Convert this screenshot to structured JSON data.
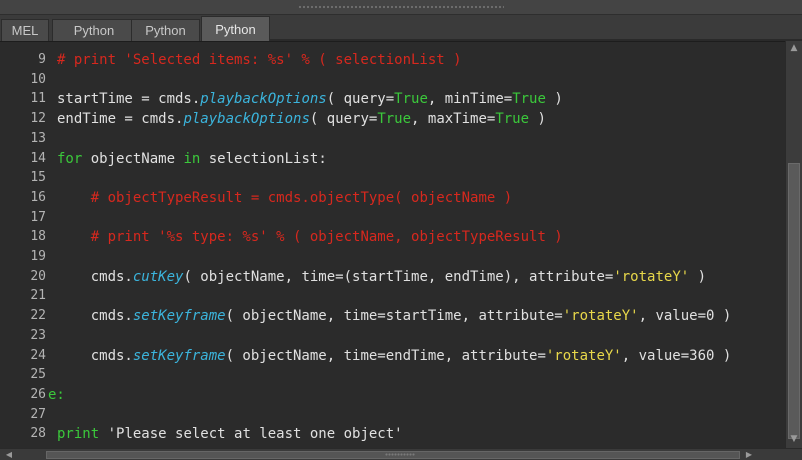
{
  "tabs": [
    {
      "label": "MEL",
      "active": false
    },
    {
      "label": "Python",
      "active": false
    },
    {
      "label": "Python",
      "active": false
    },
    {
      "label": "Python",
      "active": true
    }
  ],
  "colors": {
    "comment": "#d7281e",
    "keyword": "#3bc83b",
    "function": "#3bb4dc",
    "string": "#e8d84a",
    "text": "#e0e0e0",
    "background": "#2b2b2b"
  },
  "scroll_icons": {
    "up": "triangle-up-icon",
    "down": "triangle-down-icon",
    "left": "triangle-left-icon",
    "right": "triangle-right-icon"
  },
  "lines": [
    {
      "n": "9",
      "tokens": [
        {
          "t": "comment",
          "v": "# print 'Selected items: %s' % ( selectionList )"
        }
      ]
    },
    {
      "n": "10",
      "tokens": []
    },
    {
      "n": "11",
      "tokens": [
        {
          "t": "text",
          "v": "startTime = cmds."
        },
        {
          "t": "function",
          "v": "playbackOptions"
        },
        {
          "t": "text",
          "v": "( query="
        },
        {
          "t": "boolean",
          "v": "True"
        },
        {
          "t": "text",
          "v": ", minTime="
        },
        {
          "t": "boolean",
          "v": "True"
        },
        {
          "t": "text",
          "v": " )"
        }
      ]
    },
    {
      "n": "12",
      "tokens": [
        {
          "t": "text",
          "v": "endTime = cmds."
        },
        {
          "t": "function",
          "v": "playbackOptions"
        },
        {
          "t": "text",
          "v": "( query="
        },
        {
          "t": "boolean",
          "v": "True"
        },
        {
          "t": "text",
          "v": ", maxTime="
        },
        {
          "t": "boolean",
          "v": "True"
        },
        {
          "t": "text",
          "v": " )"
        }
      ]
    },
    {
      "n": "13",
      "tokens": []
    },
    {
      "n": "14",
      "tokens": [
        {
          "t": "keyword",
          "v": "for"
        },
        {
          "t": "text",
          "v": " objectName "
        },
        {
          "t": "keyword",
          "v": "in"
        },
        {
          "t": "text",
          "v": " selectionList:"
        }
      ]
    },
    {
      "n": "15",
      "tokens": []
    },
    {
      "n": "16",
      "tokens": [
        {
          "t": "text",
          "v": "    "
        },
        {
          "t": "comment",
          "v": "# objectTypeResult = cmds.objectType( objectName )"
        }
      ]
    },
    {
      "n": "17",
      "tokens": []
    },
    {
      "n": "18",
      "tokens": [
        {
          "t": "text",
          "v": "    "
        },
        {
          "t": "comment",
          "v": "# print '%s type: %s' % ( objectName, objectTypeResult )"
        }
      ]
    },
    {
      "n": "19",
      "tokens": []
    },
    {
      "n": "20",
      "tokens": [
        {
          "t": "text",
          "v": "    cmds."
        },
        {
          "t": "function",
          "v": "cutKey"
        },
        {
          "t": "text",
          "v": "( objectName, time=(startTime, endTime), attribute="
        },
        {
          "t": "string",
          "v": "'rotateY'"
        },
        {
          "t": "text",
          "v": " )"
        }
      ]
    },
    {
      "n": "21",
      "tokens": []
    },
    {
      "n": "22",
      "tokens": [
        {
          "t": "text",
          "v": "    cmds."
        },
        {
          "t": "function",
          "v": "setKeyframe"
        },
        {
          "t": "text",
          "v": "( objectName, time=startTime, attribute="
        },
        {
          "t": "string",
          "v": "'rotateY'"
        },
        {
          "t": "text",
          "v": ", value=0 )"
        }
      ]
    },
    {
      "n": "23",
      "tokens": []
    },
    {
      "n": "24",
      "tokens": [
        {
          "t": "text",
          "v": "    cmds."
        },
        {
          "t": "function",
          "v": "setKeyframe"
        },
        {
          "t": "text",
          "v": "( objectName, time=endTime, attribute="
        },
        {
          "t": "string",
          "v": "'rotateY'"
        },
        {
          "t": "text",
          "v": ", value=360 )"
        }
      ]
    },
    {
      "n": "25",
      "tokens": []
    },
    {
      "n": "26",
      "tokens": [
        {
          "t": "keyword",
          "v": "e:"
        }
      ]
    },
    {
      "n": "27",
      "tokens": []
    },
    {
      "n": "28",
      "tokens": [
        {
          "t": "keyword",
          "v": "print"
        },
        {
          "t": "plain-string",
          "v": " 'Please select at least one object'"
        }
      ]
    }
  ]
}
